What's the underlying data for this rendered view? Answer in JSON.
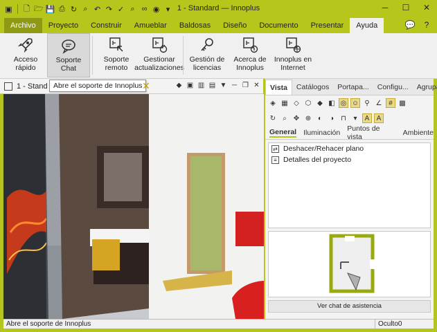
{
  "window": {
    "title": "1 - Standard — Innoplus"
  },
  "menu": {
    "tabs": [
      "Archivo",
      "Proyecto",
      "Construir",
      "Amueblar",
      "Baldosas",
      "Diseño",
      "Documento",
      "Presentar",
      "Ayuda"
    ],
    "active": "Ayuda"
  },
  "ribbon": {
    "buttons": [
      {
        "label": "Acceso\nrápido",
        "icon": "rocket-icon"
      },
      {
        "label": "Soporte\nChat",
        "icon": "chat-icon"
      },
      {
        "label": "Soporte\nremoto",
        "icon": "remote-support-icon"
      },
      {
        "label": "Gestionar\nactualizaciones",
        "icon": "update-icon"
      },
      {
        "label": "Gestión de\nlicencias",
        "icon": "key-icon"
      },
      {
        "label": "Acerca de\nInnoplus",
        "icon": "about-icon"
      },
      {
        "label": "Innoplus en\nInternet",
        "icon": "internet-icon"
      }
    ]
  },
  "document": {
    "tab_title": "1 - Stand",
    "tooltip": "Abre el soporte de Innoplus"
  },
  "right_panel": {
    "tabs": [
      "Vista",
      "Catálogos",
      "Portapa...",
      "Configu...",
      "Agrupar"
    ],
    "active_tab": "Vista",
    "subtabs": [
      "General",
      "Iluminación",
      "Puntos de vista",
      "Ambiente"
    ],
    "active_subtab": "General",
    "list_items": [
      "Deshacer/Rehacer plano",
      "Detalles del proyecto"
    ],
    "chat_button": "Ver chat de asistencia"
  },
  "statusbar": {
    "text": "Abre el soporte de Innoplus",
    "right": "Oculto0"
  },
  "colors": {
    "brand": "#b7c61a",
    "file_tab": "#8e9a14"
  }
}
